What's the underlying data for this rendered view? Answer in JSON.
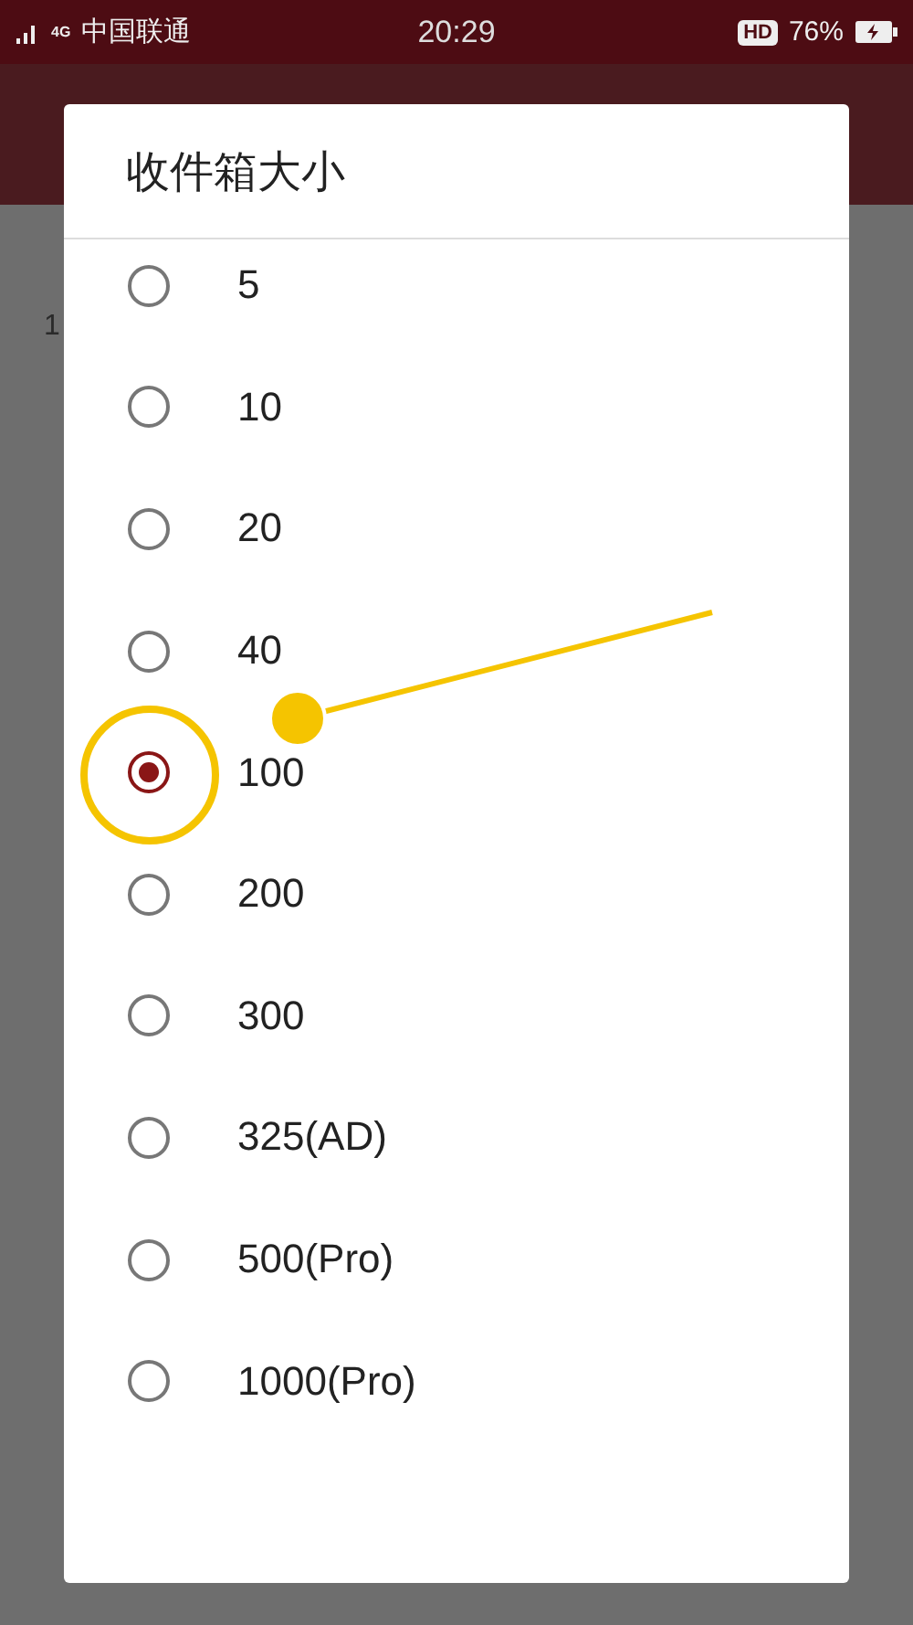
{
  "status_bar": {
    "network": "4G",
    "carrier": "中国联通",
    "time": "20:29",
    "hd_badge": "HD",
    "battery": "76%"
  },
  "background": {
    "subtitle": "1"
  },
  "dialog": {
    "title": "收件箱大小",
    "options": [
      {
        "label": "5",
        "selected": false
      },
      {
        "label": "10",
        "selected": false
      },
      {
        "label": "20",
        "selected": false
      },
      {
        "label": "40",
        "selected": false
      },
      {
        "label": "100",
        "selected": true
      },
      {
        "label": "200",
        "selected": false
      },
      {
        "label": "300",
        "selected": false
      },
      {
        "label": "325(AD)",
        "selected": false
      },
      {
        "label": "500(Pro)",
        "selected": false
      },
      {
        "label": "1000(Pro)",
        "selected": false
      }
    ]
  }
}
